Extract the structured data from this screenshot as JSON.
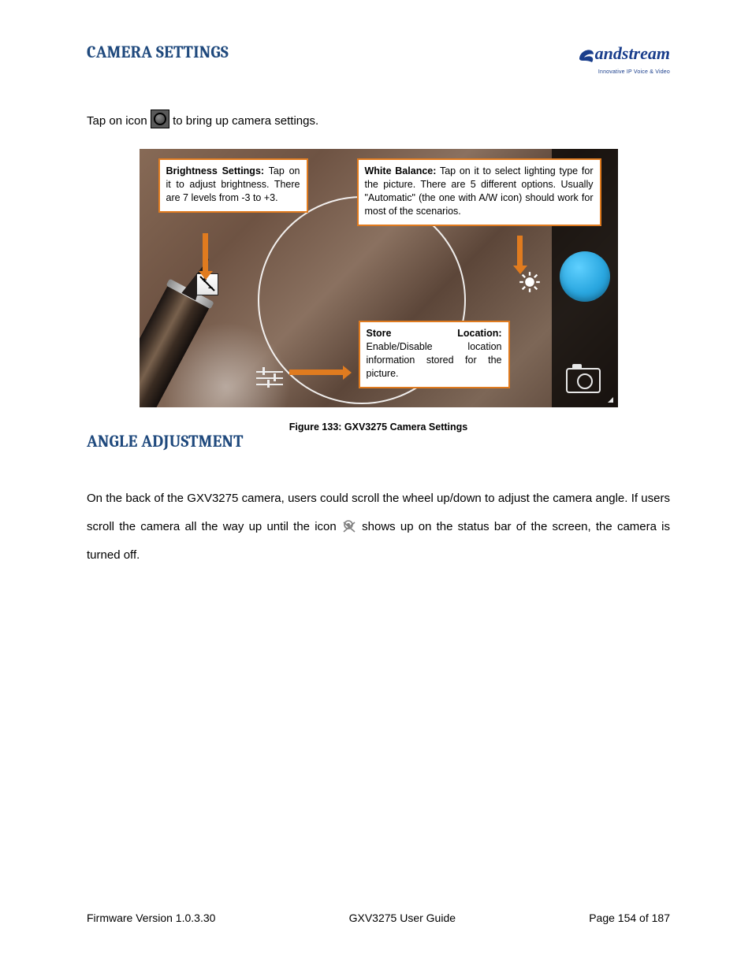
{
  "logo": {
    "brand_left": "G",
    "brand_right": "andstream",
    "tagline": "Innovative IP Voice & Video"
  },
  "heading_camera": "CAMERA SETTINGS",
  "intro_before": "Tap on icon ",
  "intro_after": " to bring up camera settings.",
  "callouts": {
    "brightness": {
      "title": "Brightness Settings:",
      "text": "Tap on it to adjust brightness. There are 7 levels from -3 to +3."
    },
    "white_balance": {
      "title": "White Balance:",
      "text": "Tap on it to select lighting type for the picture. There are 5 different options. Usually \"Automatic\" (the one with A/W icon) should work for most of the scenarios."
    },
    "store_location": {
      "title": "Store Location:",
      "text": "Enable/Disable location information stored for the picture."
    }
  },
  "figure_caption": "Figure 133: GXV3275 Camera Settings",
  "heading_angle": "ANGLE ADJUSTMENT",
  "angle_para_1": "On the back of the GXV3275 camera, users could scroll the wheel up/down to adjust the camera angle. If users scroll the camera all the way up until the icon ",
  "angle_para_2": " shows up on the status bar of the screen, the camera is turned off.",
  "footer": {
    "left": "Firmware Version 1.0.3.30",
    "center": "GXV3275 User Guide",
    "right": "Page 154 of 187"
  }
}
